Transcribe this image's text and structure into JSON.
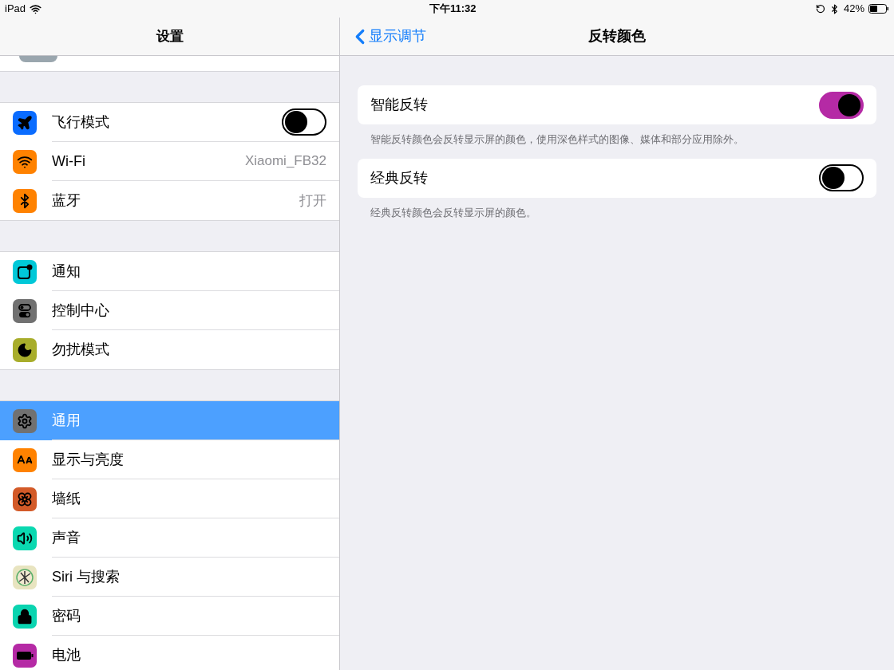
{
  "status_bar": {
    "device": "iPad",
    "time": "下午11:32",
    "battery": "42%"
  },
  "sidebar": {
    "title": "设置",
    "groups": [
      [
        {
          "label": "飞行模式",
          "color": "#0a6cff",
          "kind": "toggle",
          "on": false,
          "selected": false
        },
        {
          "label": "Wi-Fi",
          "color": "#ff8200",
          "kind": "value",
          "value": "Xiaomi_FB32",
          "selected": false
        },
        {
          "label": "蓝牙",
          "color": "#ff8200",
          "kind": "value",
          "value": "打开",
          "selected": false
        }
      ],
      [
        {
          "label": "通知",
          "color": "#00c8d8",
          "kind": "link",
          "selected": false
        },
        {
          "label": "控制中心",
          "color": "#717171",
          "kind": "link",
          "selected": false
        },
        {
          "label": "勿扰模式",
          "color": "#a8ad2b",
          "kind": "link",
          "selected": false
        }
      ],
      [
        {
          "label": "通用",
          "color": "#717171",
          "kind": "link",
          "selected": true
        },
        {
          "label": "显示与亮度",
          "color": "#ff8200",
          "kind": "link",
          "selected": false
        },
        {
          "label": "墙纸",
          "color": "#d35a28",
          "kind": "link",
          "selected": false
        },
        {
          "label": "声音",
          "color": "#0ad8b0",
          "kind": "link",
          "selected": false
        },
        {
          "label": "Siri 与搜索",
          "color": "#e8e4c0",
          "kind": "link",
          "selected": false
        },
        {
          "label": "密码",
          "color": "#0ad4b0",
          "kind": "link",
          "selected": false
        },
        {
          "label": "电池",
          "color": "#b52aa5",
          "kind": "link",
          "selected": false
        }
      ]
    ]
  },
  "detail": {
    "back": "显示调节",
    "title": "反转颜色",
    "sections": [
      {
        "label": "智能反转",
        "on": true,
        "footer": "智能反转颜色会反转显示屏的颜色，使用深色样式的图像、媒体和部分应用除外。"
      },
      {
        "label": "经典反转",
        "on": false,
        "footer": "经典反转颜色会反转显示屏的颜色。"
      }
    ]
  }
}
